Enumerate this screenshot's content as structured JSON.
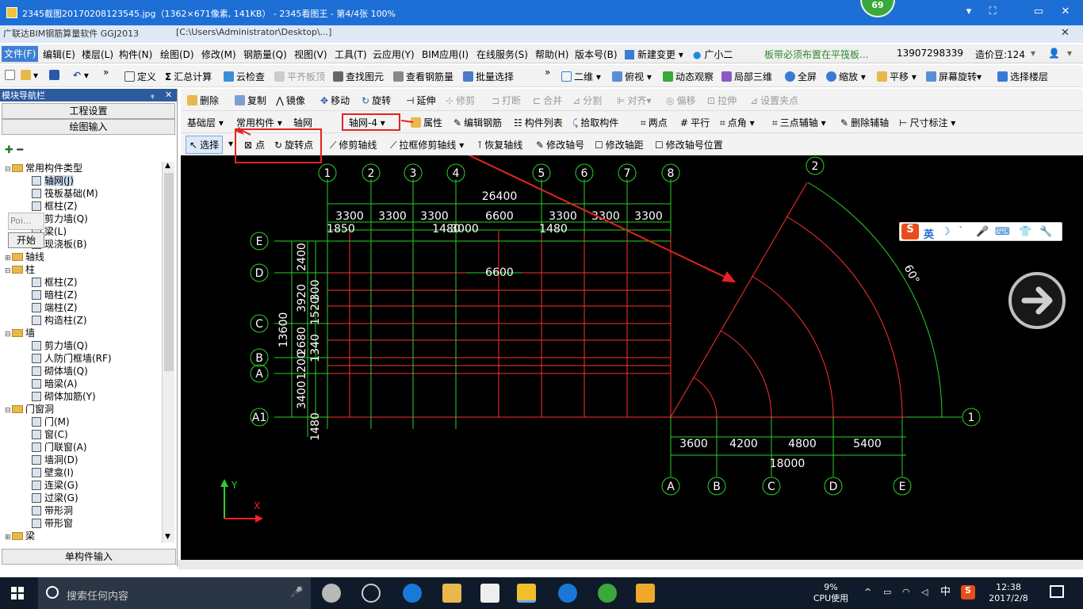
{
  "titlebar": {
    "title": "2345截图20170208123545.jpg（1362×671像素, 141KB） - 2345看图王 - 第4/4张 100%",
    "notif_count": "69",
    "min": "▾",
    "restore": "⛶",
    "max": "▭",
    "close": "✕"
  },
  "path": {
    "left": "广联达BIM钢筋算量软件 GGJ2013",
    "right": "[C:\\Users\\Administrator\\Desktop\\...]"
  },
  "menu": [
    "文件(F)",
    "编辑(E)",
    "楼层(L)",
    "构件(N)",
    "绘图(D)",
    "修改(M)",
    "钢筋量(Q)",
    "视图(V)",
    "工具(T)",
    "云应用(Y)",
    "BIM应用(I)",
    "在线服务(S)",
    "帮助(H)",
    "版本号(B)",
    "新建变更",
    "广小二",
    "板带必须布置在平筏板...",
    "13907298339",
    "造价豆:124"
  ],
  "toolbar1": [
    "定义",
    "汇总计算",
    "云检查",
    "平齐板顶",
    "查找图元",
    "查看钢筋量",
    "批量选择",
    "二维",
    "俯视",
    "动态观察",
    "局部三维",
    "全屏",
    "缩放",
    "平移",
    "屏幕旋转",
    "选择楼层"
  ],
  "toolbar2": [
    "删除",
    "复制",
    "镜像",
    "移动",
    "旋转",
    "延伸",
    "修剪",
    "打断",
    "合并",
    "分割",
    "对齐",
    "偏移",
    "拉伸",
    "设置夹点"
  ],
  "toolbar3": {
    "floor": "基础层",
    "comp_type": "常用构件",
    "comp": "轴网",
    "selected_grid": "轴网-4",
    "items": [
      "属性",
      "编辑钢筋",
      "构件列表",
      "拾取构件",
      "两点",
      "平行",
      "点角",
      "三点辅轴",
      "删除辅轴",
      "尺寸标注"
    ]
  },
  "toolbar4": {
    "select": "选择",
    "point": "点",
    "rotate_point": "旋转点",
    "items": [
      "修剪轴线",
      "拉框修剪轴线",
      "恢复轴线",
      "修改轴号",
      "修改轴距",
      "修改轴号位置"
    ]
  },
  "sidebar": {
    "title": "模块导航栏",
    "pin": "ᵩ",
    "close": "✕",
    "btn_project": "工程设置",
    "btn_draw": "绘图输入",
    "btn_single": "单构件输入",
    "float_label": "Poi...",
    "float_btn": "开始",
    "tree": [
      {
        "label": "常用构件类型",
        "kind": "folder",
        "level": 0,
        "exp": "⊟"
      },
      {
        "label": "轴网(J)",
        "kind": "item",
        "level": 1,
        "sel": true
      },
      {
        "label": "筏板基础(M)",
        "kind": "item",
        "level": 1
      },
      {
        "label": "框柱(Z)",
        "kind": "item",
        "level": 1
      },
      {
        "label": "剪力墙(Q)",
        "kind": "item",
        "level": 1
      },
      {
        "label": "梁(L)",
        "kind": "item",
        "level": 1
      },
      {
        "label": "现浇板(B)",
        "kind": "item",
        "level": 1
      },
      {
        "label": "轴线",
        "kind": "folder",
        "level": 0,
        "exp": "⊞"
      },
      {
        "label": "柱",
        "kind": "folder",
        "level": 0,
        "exp": "⊟"
      },
      {
        "label": "框柱(Z)",
        "kind": "item",
        "level": 1
      },
      {
        "label": "暗柱(Z)",
        "kind": "item",
        "level": 1
      },
      {
        "label": "端柱(Z)",
        "kind": "item",
        "level": 1
      },
      {
        "label": "构造柱(Z)",
        "kind": "item",
        "level": 1
      },
      {
        "label": "墙",
        "kind": "folder",
        "level": 0,
        "exp": "⊟"
      },
      {
        "label": "剪力墙(Q)",
        "kind": "item",
        "level": 1
      },
      {
        "label": "人防门框墙(RF)",
        "kind": "item",
        "level": 1
      },
      {
        "label": "砌体墙(Q)",
        "kind": "item",
        "level": 1
      },
      {
        "label": "暗梁(A)",
        "kind": "item",
        "level": 1
      },
      {
        "label": "砌体加筋(Y)",
        "kind": "item",
        "level": 1
      },
      {
        "label": "门窗洞",
        "kind": "folder",
        "level": 0,
        "exp": "⊟"
      },
      {
        "label": "门(M)",
        "kind": "item",
        "level": 1
      },
      {
        "label": "窗(C)",
        "kind": "item",
        "level": 1
      },
      {
        "label": "门联窗(A)",
        "kind": "item",
        "level": 1
      },
      {
        "label": "墙洞(D)",
        "kind": "item",
        "level": 1
      },
      {
        "label": "壁龛(I)",
        "kind": "item",
        "level": 1
      },
      {
        "label": "连梁(G)",
        "kind": "item",
        "level": 1
      },
      {
        "label": "过梁(G)",
        "kind": "item",
        "level": 1
      },
      {
        "label": "带形洞",
        "kind": "item",
        "level": 1
      },
      {
        "label": "带形窗",
        "kind": "item",
        "level": 1
      },
      {
        "label": "梁",
        "kind": "folder",
        "level": 0,
        "exp": "⊞"
      }
    ]
  },
  "cad": {
    "top_axes": [
      "1",
      "2",
      "3",
      "4",
      "5",
      "6",
      "7",
      "8"
    ],
    "left_axes": [
      "E",
      "D",
      "C",
      "B",
      "A",
      "A1"
    ],
    "total_top": "26400",
    "spans_top": [
      "3300",
      "3300",
      "3300",
      "6600",
      "3300",
      "3300",
      "3300"
    ],
    "sub_top": [
      "1850",
      "1480",
      "3000",
      "1480"
    ],
    "mid_dim": "6600",
    "left_total": "13600",
    "left_dims": [
      "2400",
      "3920",
      "2680",
      "1200",
      "3400",
      "1480"
    ],
    "left_dims2": [
      "300",
      "1520",
      "1340"
    ],
    "arc_axes": [
      "A",
      "B",
      "C",
      "D",
      "E"
    ],
    "arc_spans": [
      "3600",
      "4200",
      "4800",
      "5400"
    ],
    "arc_total": "18000",
    "arc_axis_1": "1",
    "arc_axis_2": "2",
    "arc_angle": "60°",
    "ucs_y": "Y",
    "ucs_x": "X"
  },
  "ime": {
    "logo": "S",
    "lang": "英",
    "icons": [
      "☽",
      "ˋ",
      "🎤",
      "⌨",
      "👕",
      "🔧"
    ]
  },
  "taskbar": {
    "search": "搜索任何内容",
    "cpu": "9%",
    "cpu_label": "CPU使用",
    "ime": "中",
    "time": "12:38",
    "date": "2017/2/8"
  }
}
